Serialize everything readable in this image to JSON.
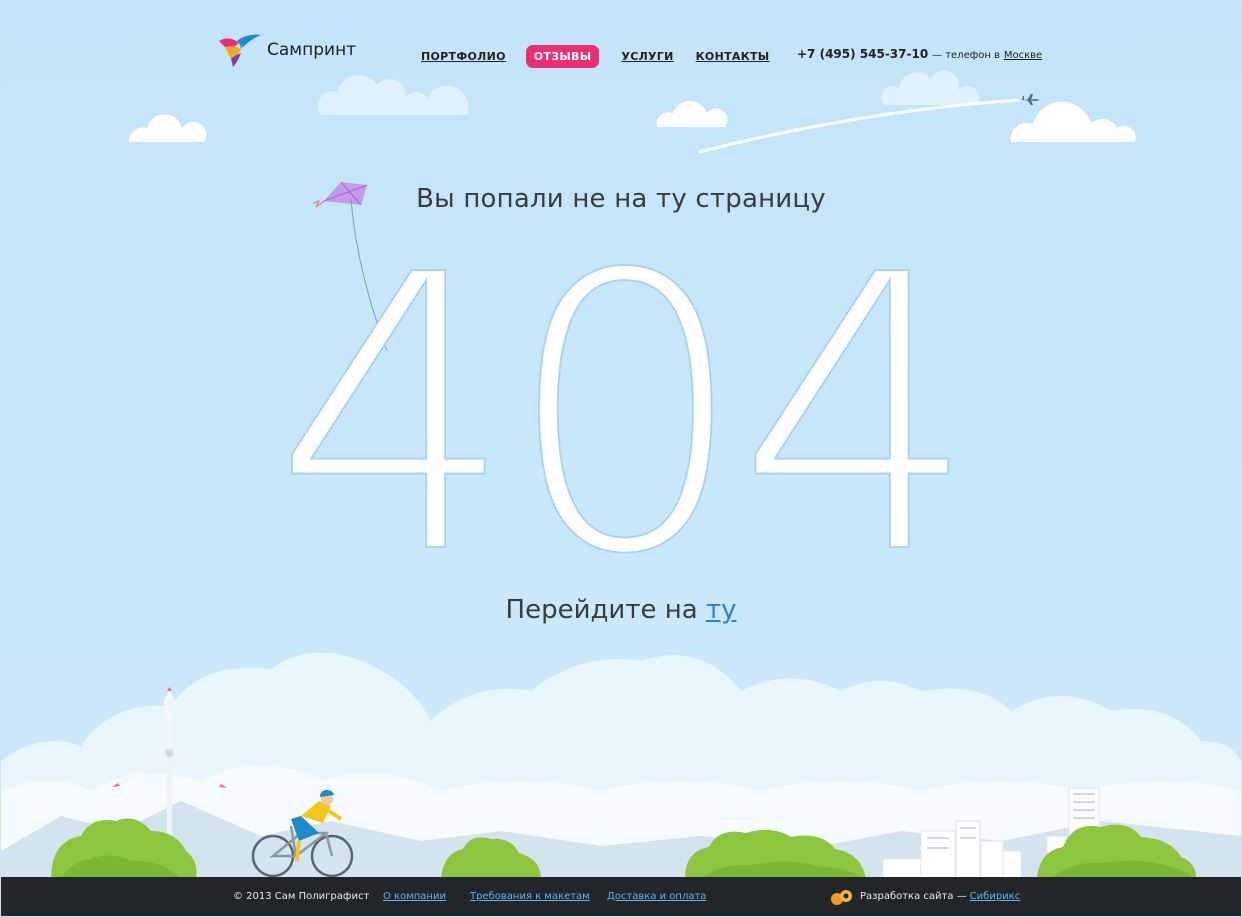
{
  "header": {
    "logo_text": "Сампринт",
    "nav": [
      {
        "label": "ПОРТФОЛИО"
      },
      {
        "label": "ОТЗЫВЫ"
      },
      {
        "label": "УСЛУГИ"
      },
      {
        "label": "КОНТАКТЫ"
      }
    ],
    "phone": "+7 (495) 545-37-10",
    "phone_sub": "— телефон в",
    "city": "Москве"
  },
  "main": {
    "headline": "Вы попали не на ту страницу",
    "code": "404",
    "redirect_prefix": "Перейдите на",
    "redirect_link": "ту"
  },
  "footer": {
    "copyright": "© 2013 Сам Полиграфист",
    "links": [
      "О компании",
      "Требования к макетам",
      "Доставка и оплата"
    ],
    "dev_prefix": "Разработка сайта —",
    "dev_link": "Сибирикс"
  },
  "colors": {
    "accent": "#ec2f72",
    "link": "#2f7fcc",
    "footer_bg": "#222629",
    "bush": "#8cc63f"
  }
}
